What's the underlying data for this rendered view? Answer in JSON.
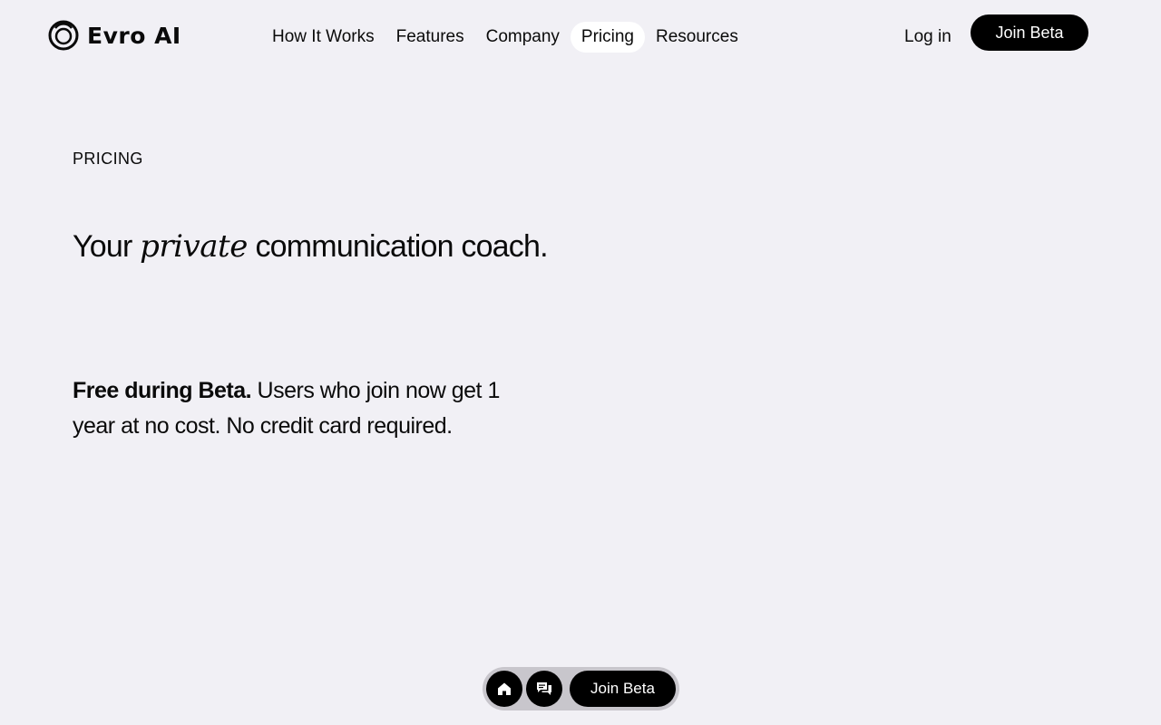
{
  "brand": {
    "name": "Evro AI",
    "logo_icon": "ring-logo-icon"
  },
  "nav": {
    "items": [
      {
        "label": "How It Works"
      },
      {
        "label": "Features"
      },
      {
        "label": "Company"
      },
      {
        "label": "Pricing",
        "active": true
      },
      {
        "label": "Resources"
      }
    ],
    "login_label": "Log in",
    "join_label": "Join Beta"
  },
  "hero": {
    "eyebrow": "PRICING",
    "headline_prefix": "Your",
    "headline_accent": "private",
    "headline_suffix": "communication coach.",
    "desc_bold": "Free during Beta.",
    "desc_rest": " Users who join now get 1 year at no cost. No credit card required."
  },
  "dock": {
    "home_icon": "home-icon",
    "chat_icon": "chat-icon",
    "join_label": "Join Beta"
  },
  "colors": {
    "background": "#f1f0f5",
    "primary": "#000000",
    "dock_bg": "#c8c6cc",
    "active_nav_bg": "#ffffff"
  }
}
